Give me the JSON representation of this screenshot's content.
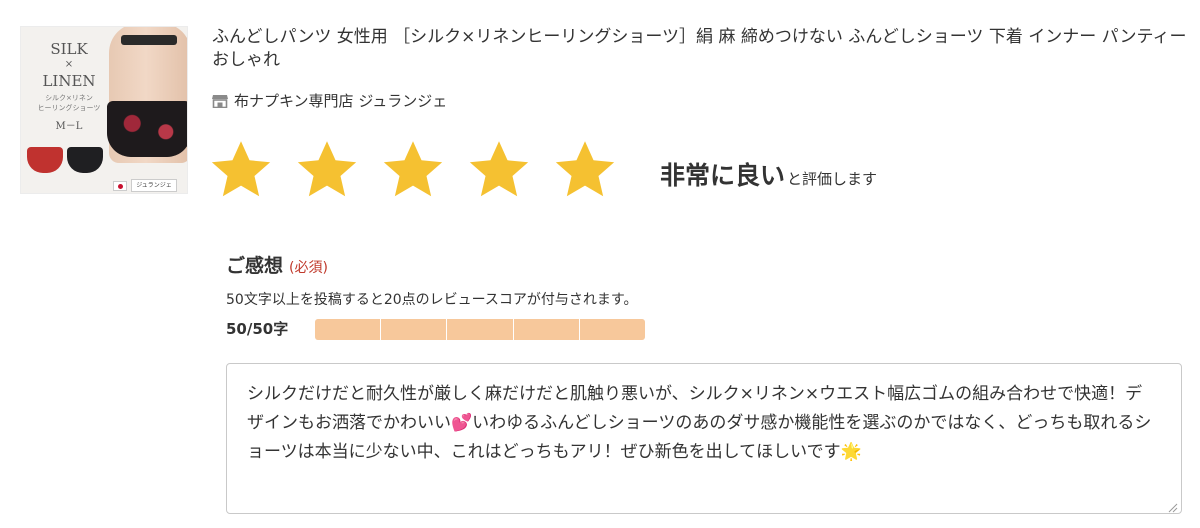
{
  "product": {
    "image_alt": "SILK × LINEN product image",
    "image_text": {
      "brand_line1": "SILK",
      "brand_x": "×",
      "brand_line2": "LINEN",
      "subtitle_line1": "シルク×リネン",
      "subtitle_line2": "ヒーリングショーツ",
      "size": "M－L",
      "tag": "ジュランジェ"
    },
    "title": "ふんどしパンツ 女性用 ［シルク×リネンヒーリングショーツ］絹 麻 締めつけない ふんどしショーツ 下着 インナー パンティー おしゃれ",
    "shop_icon": "shop-icon",
    "shop_name": "布ナプキン専門店 ジュランジェ"
  },
  "rating": {
    "value": 5,
    "max": 5,
    "star_color": "#f5c131",
    "label_big": "非常に良い",
    "label_small": "と評価します"
  },
  "review": {
    "section_title": "ご感想",
    "required_label": "(必須)",
    "hint": "50文字以上を投稿すると20点のレビュースコアが付与されます。",
    "char_count": "50/50字",
    "progress_fraction": 1.0,
    "progress_segments": 5,
    "progress_color": "#f7c89b",
    "text": "シルクだけだと耐久性が厳しく麻だけだと肌触り悪いが、シルク×リネン×ウエスト幅広ゴムの組み合わせで快適！デザインもお洒落でかわいい💕いわゆるふんどしショーツのあのダサ感か機能性を選ぶのかではなく、どっちも取れるショーツは本当に少ない中、これはどっちもアリ！ぜひ新色を出してほしいです🌟"
  }
}
